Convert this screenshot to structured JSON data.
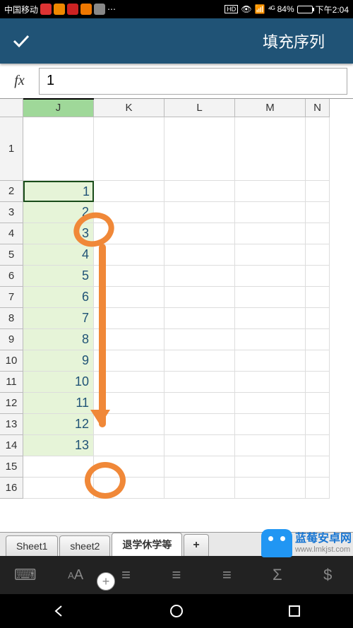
{
  "status": {
    "carrier": "中国移动",
    "icons": [
      "red",
      "orange",
      "red",
      "orange",
      "grey",
      "dots"
    ],
    "right": {
      "hd": "HD",
      "net": "4G",
      "signal": "⁴ᴳ",
      "battery_pct": "84%",
      "time": "下午2:04"
    }
  },
  "header": {
    "title": "填充序列"
  },
  "formula": {
    "fx": "fx",
    "value": "1"
  },
  "columns": [
    "J",
    "K",
    "L",
    "M",
    "N"
  ],
  "rows": [
    {
      "n": "1",
      "val": ""
    },
    {
      "n": "2",
      "val": "1"
    },
    {
      "n": "3",
      "val": "2"
    },
    {
      "n": "4",
      "val": "3"
    },
    {
      "n": "5",
      "val": "4"
    },
    {
      "n": "6",
      "val": "5"
    },
    {
      "n": "7",
      "val": "6"
    },
    {
      "n": "8",
      "val": "7"
    },
    {
      "n": "9",
      "val": "8"
    },
    {
      "n": "10",
      "val": "9"
    },
    {
      "n": "11",
      "val": "10"
    },
    {
      "n": "12",
      "val": "11"
    },
    {
      "n": "13",
      "val": "12"
    },
    {
      "n": "14",
      "val": "13"
    },
    {
      "n": "15",
      "val": ""
    },
    {
      "n": "16",
      "val": ""
    }
  ],
  "selected_col_index": 0,
  "active_row_index": 1,
  "fill_range_end": 13,
  "fill_handle": "+",
  "tabs": {
    "items": [
      "Sheet1",
      "sheet2",
      "退学休学等"
    ],
    "active": 2,
    "add": "+"
  },
  "toolbar": {
    "items": [
      "keyboard",
      "font",
      "align-left",
      "align-center",
      "align-right",
      "sum",
      "currency"
    ]
  },
  "watermark": {
    "name": "蓝莓安卓网",
    "url": "www.lmkjst.com"
  }
}
